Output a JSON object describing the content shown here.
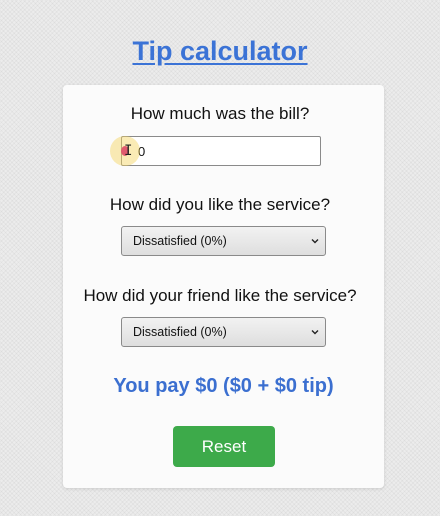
{
  "app": {
    "title": "Tip calculator"
  },
  "bill": {
    "label": "How much was the bill?",
    "value": "0"
  },
  "service_you": {
    "label": "How did you like the service?",
    "selected": "Dissatisfied (0%)"
  },
  "service_friend": {
    "label": "How did your friend like the service?",
    "selected": "Dissatisfied (0%)"
  },
  "result": {
    "text": "You pay $0 ($0 + $0 tip)"
  },
  "reset": {
    "label": "Reset"
  },
  "colors": {
    "accent": "#3b73d6",
    "button": "#3daa4a",
    "background": "#ececec",
    "card": "#fbfbfb"
  },
  "icons": {
    "select_arrow": "chevron-down-icon",
    "text_cursor": "i-beam-cursor-icon"
  }
}
